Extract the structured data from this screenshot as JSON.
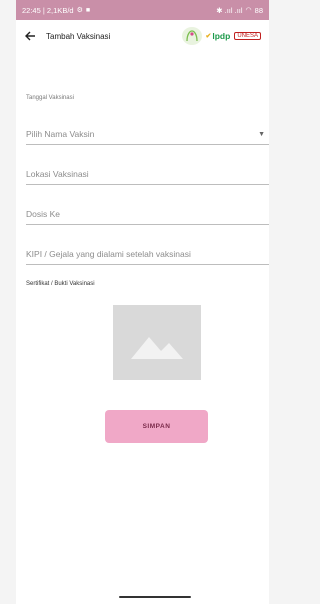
{
  "status_bar": {
    "left_text": "22:45 | 2,1KB/d",
    "right_text": "✱ .ııl .ııl",
    "battery": "88"
  },
  "header": {
    "title": "Tambah Vaksinasi",
    "logos": {
      "lpdp": "lpdp",
      "university": "UNESA"
    }
  },
  "form": {
    "date_label": "Tanggal Vaksinasi",
    "vaccine_placeholder": "Pilih Nama Vaksin",
    "location_placeholder": "Lokasi Vaksinasi",
    "dose_placeholder": "Dosis Ke",
    "kipi_placeholder": "KIPI / Gejala yang dialami setelah vaksinasi",
    "certificate_label": "Sertifikat / Bukti Vaksinasi"
  },
  "actions": {
    "save_label": "SIMPAN"
  },
  "colors": {
    "status_bar": "#c98fa8",
    "save_button": "#f0a8c7",
    "placeholder": "#d9d9d9"
  }
}
